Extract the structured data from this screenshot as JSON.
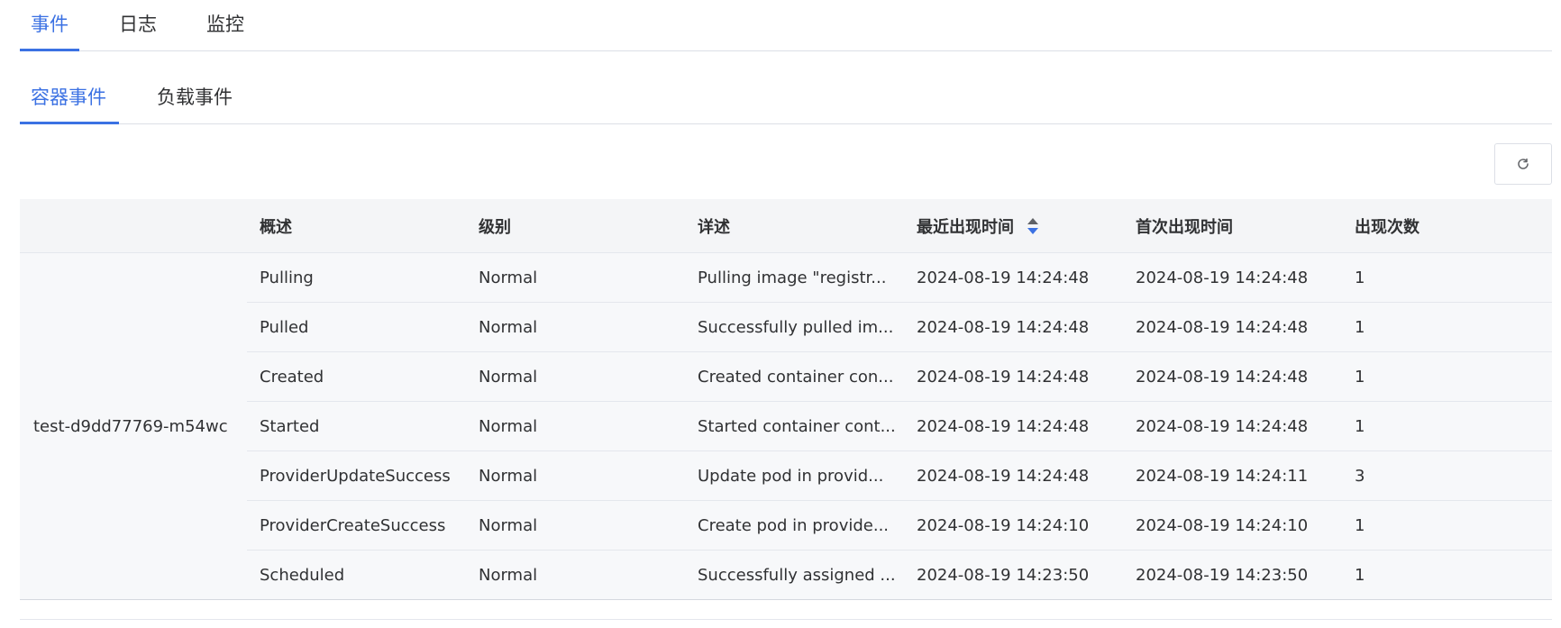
{
  "primary_tabs": [
    "事件",
    "日志",
    "监控"
  ],
  "secondary_tabs": [
    "容器事件",
    "负载事件"
  ],
  "toolbar": {
    "refresh_icon": "refresh-icon"
  },
  "table": {
    "columns": [
      "",
      "概述",
      "级别",
      "详述",
      "最近出现时间",
      "首次出现时间",
      "出现次数"
    ],
    "sorted_column": "最近出现时间",
    "pod_name": "test-d9dd77769-m54wc",
    "rows": [
      {
        "summary": "Pulling",
        "level": "Normal",
        "detail": "Pulling image \"registr...",
        "last_seen": "2024-08-19 14:24:48",
        "first_seen": "2024-08-19 14:24:48",
        "count": "1"
      },
      {
        "summary": "Pulled",
        "level": "Normal",
        "detail": "Successfully pulled im...",
        "last_seen": "2024-08-19 14:24:48",
        "first_seen": "2024-08-19 14:24:48",
        "count": "1"
      },
      {
        "summary": "Created",
        "level": "Normal",
        "detail": "Created container con...",
        "last_seen": "2024-08-19 14:24:48",
        "first_seen": "2024-08-19 14:24:48",
        "count": "1"
      },
      {
        "summary": "Started",
        "level": "Normal",
        "detail": "Started container cont...",
        "last_seen": "2024-08-19 14:24:48",
        "first_seen": "2024-08-19 14:24:48",
        "count": "1"
      },
      {
        "summary": "ProviderUpdateSuccess",
        "level": "Normal",
        "detail": "Update pod in provid...",
        "last_seen": "2024-08-19 14:24:48",
        "first_seen": "2024-08-19 14:24:11",
        "count": "3"
      },
      {
        "summary": "ProviderCreateSuccess",
        "level": "Normal",
        "detail": "Create pod in provide...",
        "last_seen": "2024-08-19 14:24:10",
        "first_seen": "2024-08-19 14:24:10",
        "count": "1"
      },
      {
        "summary": "Scheduled",
        "level": "Normal",
        "detail": "Successfully assigned ...",
        "last_seen": "2024-08-19 14:23:50",
        "first_seen": "2024-08-19 14:23:50",
        "count": "1"
      }
    ]
  },
  "colors": {
    "accent": "#3b71e3",
    "header_bg": "#f4f5f7",
    "row_bg": "#f7f8fa",
    "border": "#e4e7ed"
  }
}
